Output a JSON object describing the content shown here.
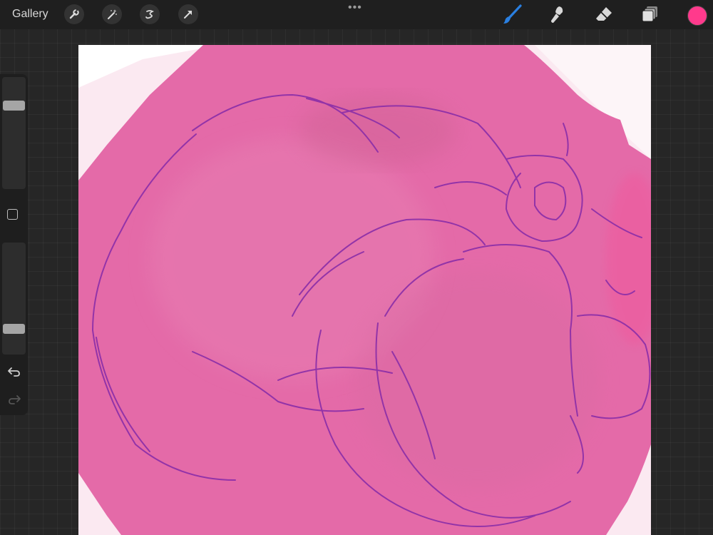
{
  "toolbar": {
    "gallery_label": "Gallery",
    "left_tools": [
      "wrench-icon",
      "magic-wand-icon",
      "selection-icon",
      "transform-arrow-icon"
    ],
    "more_label": "•••",
    "right_tools": [
      "brush-icon",
      "smudge-icon",
      "eraser-icon",
      "layers-icon"
    ],
    "active_tool": "brush",
    "current_color": "#ff3a8c",
    "accent_color": "#2a7fe0"
  },
  "sidebar": {
    "controls": [
      "brush-size-slider",
      "modify-button",
      "opacity-slider",
      "undo-icon",
      "redo-icon"
    ],
    "redo_enabled": false
  },
  "canvas": {
    "paint_color": "#e46aa8",
    "sketch_color": "#8a2ea8"
  }
}
